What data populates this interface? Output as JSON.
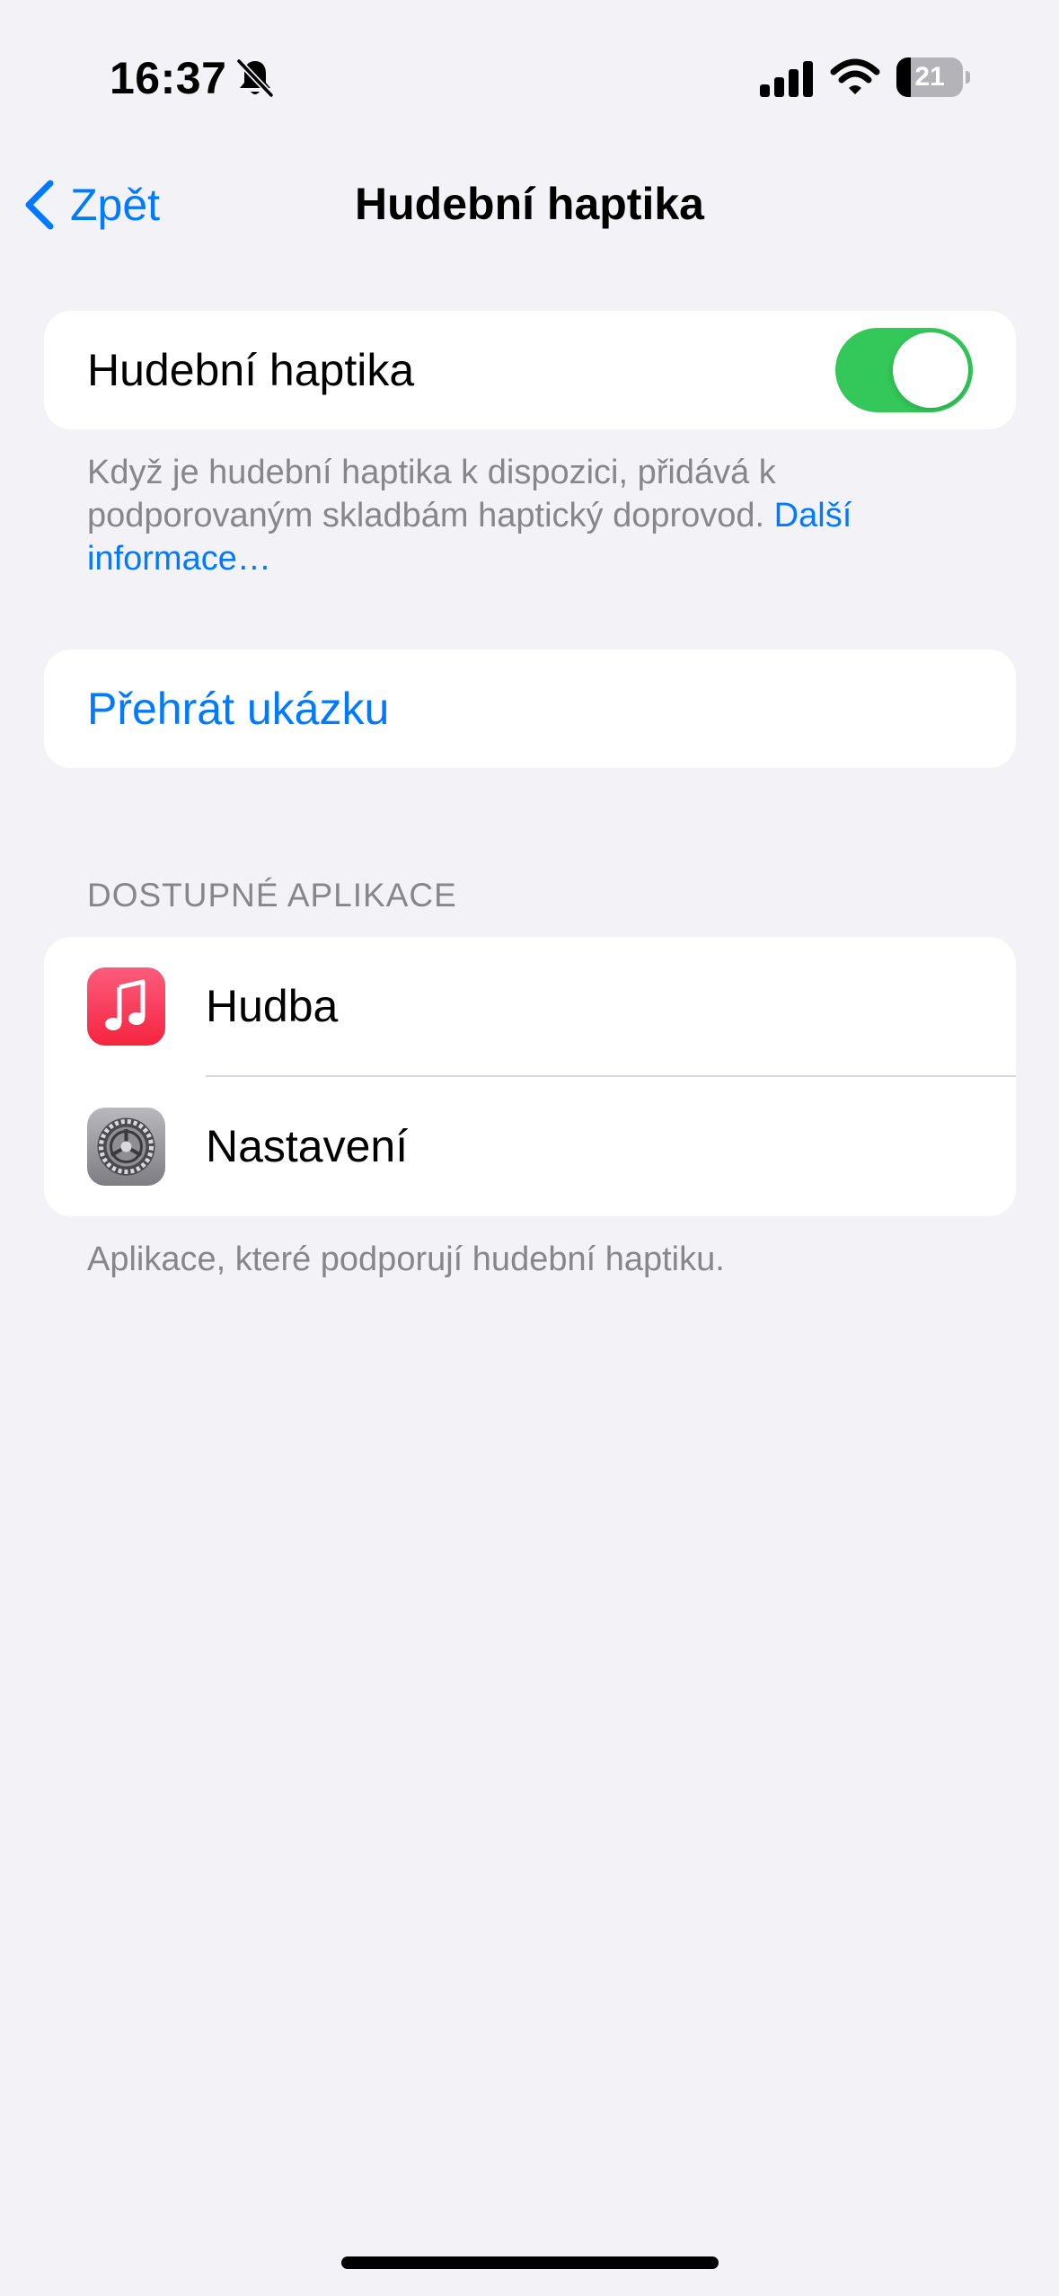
{
  "status_bar": {
    "time": "16:37",
    "battery_level": "21",
    "battery_fraction": 0.21,
    "icons": [
      "bell-slash-icon",
      "cellular-signal-icon",
      "wifi-icon",
      "battery-icon"
    ]
  },
  "nav": {
    "back_label": "Zpět",
    "title": "Hudební haptika"
  },
  "toggle_section": {
    "label": "Hudební haptika",
    "enabled": true,
    "footer_text": "Když je hudební haptika k dispozici, přidává k podporovaným skladbám haptický doprovod. ",
    "footer_link": "Další informace…"
  },
  "play_section": {
    "label": "Přehrát ukázku"
  },
  "apps_section": {
    "header": "DOSTUPNÉ APLIKACE",
    "items": [
      {
        "label": "Hudba",
        "icon": "music-app-icon"
      },
      {
        "label": "Nastavení",
        "icon": "settings-app-icon"
      }
    ],
    "footer_text": "Aplikace, které podporují hudební haptiku."
  },
  "colors": {
    "accent": "#007aff",
    "switch_on": "#34c759",
    "background": "#f2f2f7",
    "music_icon": "#fa3c5a"
  }
}
